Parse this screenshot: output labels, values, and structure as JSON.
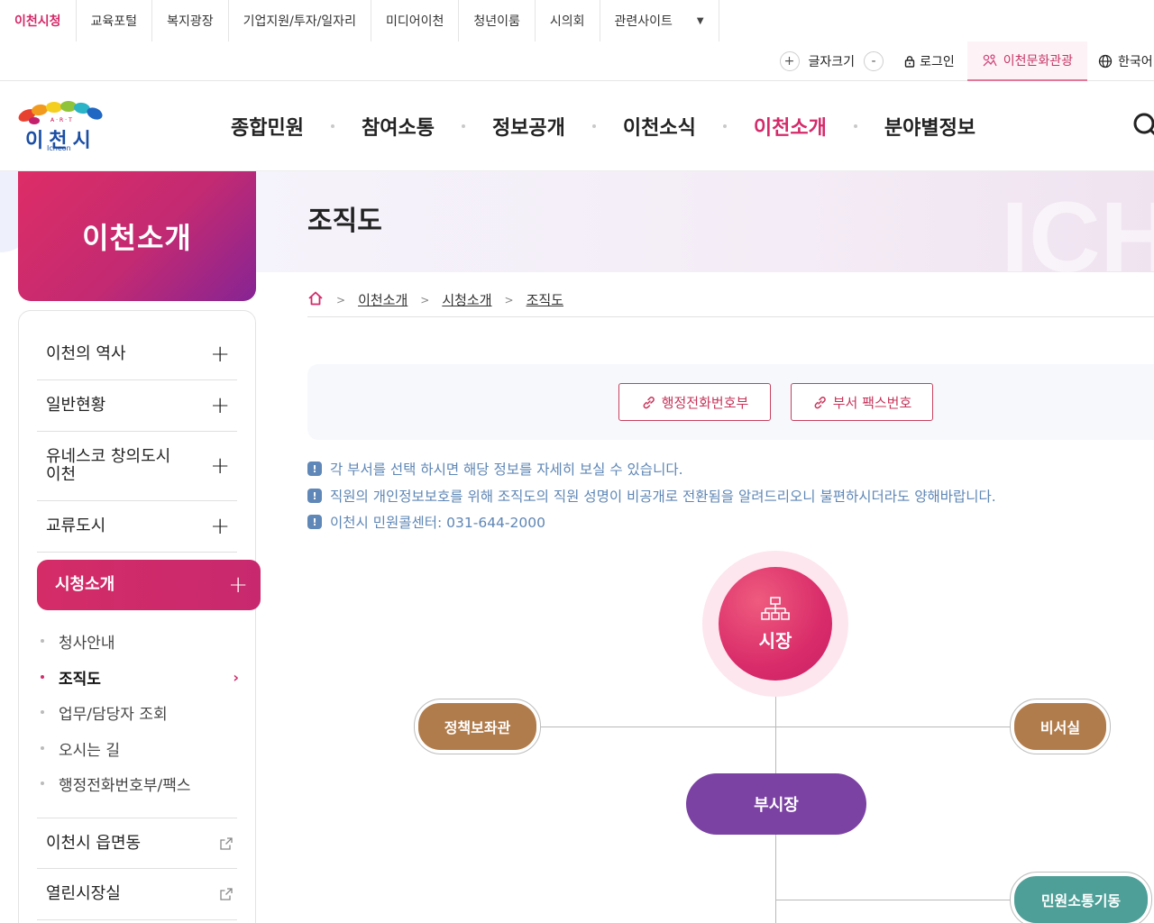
{
  "site_tabs": [
    "이천시청",
    "교육포털",
    "복지광장",
    "기업지원/투자/일자리",
    "미디어이천",
    "청년이룸",
    "시의회"
  ],
  "related_sites": "관련사이트",
  "utility": {
    "plus": "+",
    "font_size": "글자크기",
    "minus": "-",
    "login": "로그인",
    "culture": "이천문화관광",
    "language": "한국어"
  },
  "logo": {
    "art": "A·R·T",
    "name": "이천시",
    "sub": "Icheon"
  },
  "gnb": [
    "종합민원",
    "참여소통",
    "정보공개",
    "이천소식",
    "이천소개",
    "분야별정보"
  ],
  "gnb_active_index": 4,
  "sidebar": {
    "title": "이천소개",
    "items": [
      "이천의 역사",
      "일반현황",
      "유네스코 창의도시 이천",
      "교류도시",
      "시청소개"
    ],
    "sub_items": [
      "청사안내",
      "조직도",
      "업무/담당자 조회",
      "오시는 길",
      "행정전화번호부/팩스"
    ],
    "current_sub": "조직도",
    "external_items": [
      "이천시 읍면동",
      "열린시장실"
    ],
    "plus": "+"
  },
  "page": {
    "title": "조직도",
    "banner_deco": "ICH",
    "breadcrumb": [
      "이천소개",
      "시청소개",
      "조직도"
    ],
    "buttons": [
      "행정전화번호부",
      "부서 팩스번호"
    ],
    "notices": [
      "각 부서를 선택 하시면 해당 정보를 자세히 보실 수 있습니다.",
      "직원의 개인정보보호를 위해 조직도의 직원 성명이 비공개로 전환됨을 알려드리오니 불편하시더라도 양해바랍니다.",
      "이천시 민원콜센터: 031-644-2000"
    ],
    "notice_icon": "!"
  },
  "org": {
    "mayor": "시장",
    "policy_advisor": "정책보좌관",
    "secretary": "비서실",
    "vice_mayor": "부시장",
    "civil_comm": "민원소통기동"
  },
  "colors": {
    "accent": "#d32b6a",
    "vice": "#7b42a3",
    "brown": "#b17c4c",
    "teal": "#4e9f98",
    "notice": "#5e86b5"
  }
}
